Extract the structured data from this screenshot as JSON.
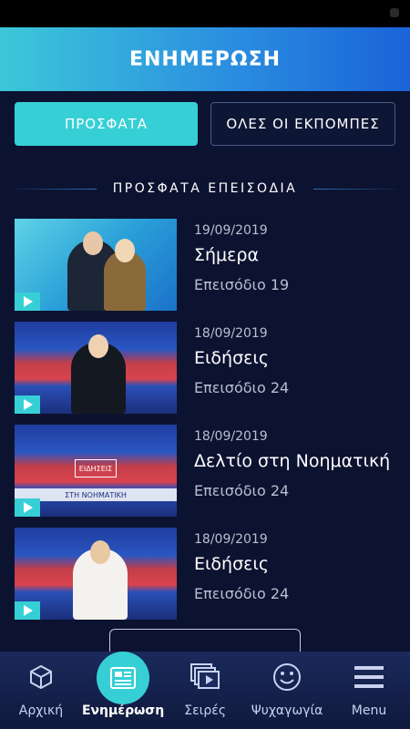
{
  "header": {
    "title": "ΕΝΗΜΕΡΩΣΗ"
  },
  "tabs": [
    {
      "label": "ΠΡΟΣΦΑΤΑ",
      "active": true
    },
    {
      "label": "ΟΛΕΣ ΟΙ ΕΚΠΟΜΠΕΣ",
      "active": false
    }
  ],
  "section": {
    "title": "ΠΡΟΣΦΑΤΑ ΕΠΕΙΣΟΔΙΑ"
  },
  "episodes": [
    {
      "date": "19/09/2019",
      "title": "Σήμερα",
      "episode": "Επεισόδιο 19"
    },
    {
      "date": "18/09/2019",
      "title": "Ειδήσεις",
      "episode": "Επεισόδιο 24"
    },
    {
      "date": "18/09/2019",
      "title": "Δελτίο στη Νοηματική",
      "episode": "Επεισόδιο 24",
      "thumb_text_top": "ΕΙΔΗΣΕΙΣ",
      "thumb_text_bottom": "ΣΤΗ ΝΟΗΜΑΤΙΚΗ"
    },
    {
      "date": "18/09/2019",
      "title": "Ειδήσεις",
      "episode": "Επεισόδιο 24"
    }
  ],
  "bottom_nav": [
    {
      "label": "Αρχική",
      "icon": "cube-icon",
      "active": false
    },
    {
      "label": "Ενημέρωση",
      "icon": "newspaper-icon",
      "active": true
    },
    {
      "label": "Σειρές",
      "icon": "play-stack-icon",
      "active": false
    },
    {
      "label": "Ψυχαγωγία",
      "icon": "smiley-icon",
      "active": false
    },
    {
      "label": "Menu",
      "icon": "hamburger-icon",
      "active": false
    }
  ],
  "colors": {
    "accent": "#37cfd6",
    "background": "#0c1330",
    "header_start": "#3cc8d8",
    "header_end": "#1a63d8"
  }
}
